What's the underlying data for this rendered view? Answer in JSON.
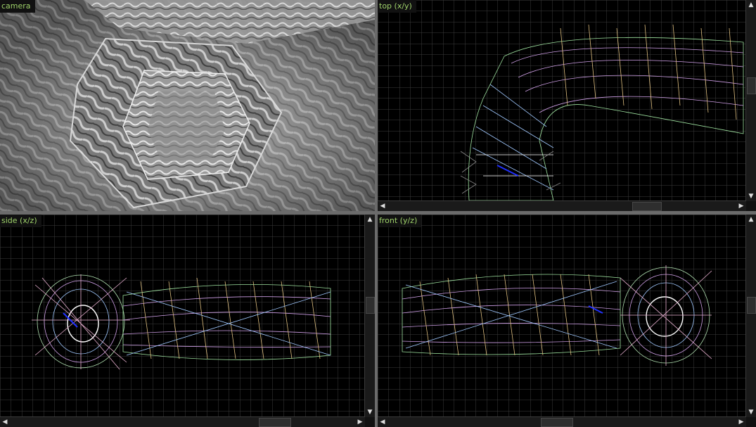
{
  "viewports": {
    "camera": {
      "label": "camera"
    },
    "top": {
      "label": "top (x/y)"
    },
    "side": {
      "label": "side (x/z)"
    },
    "front": {
      "label": "front (y/z)"
    }
  },
  "icons": {
    "arrow_up": "▲",
    "arrow_down": "▼",
    "arrow_left": "◀",
    "arrow_right": "▶"
  },
  "colors": {
    "label_text": "#9fd36a",
    "grid_line": "#3c3c3c",
    "viewport_bg": "#000000",
    "divider": "#6b6b6b"
  }
}
